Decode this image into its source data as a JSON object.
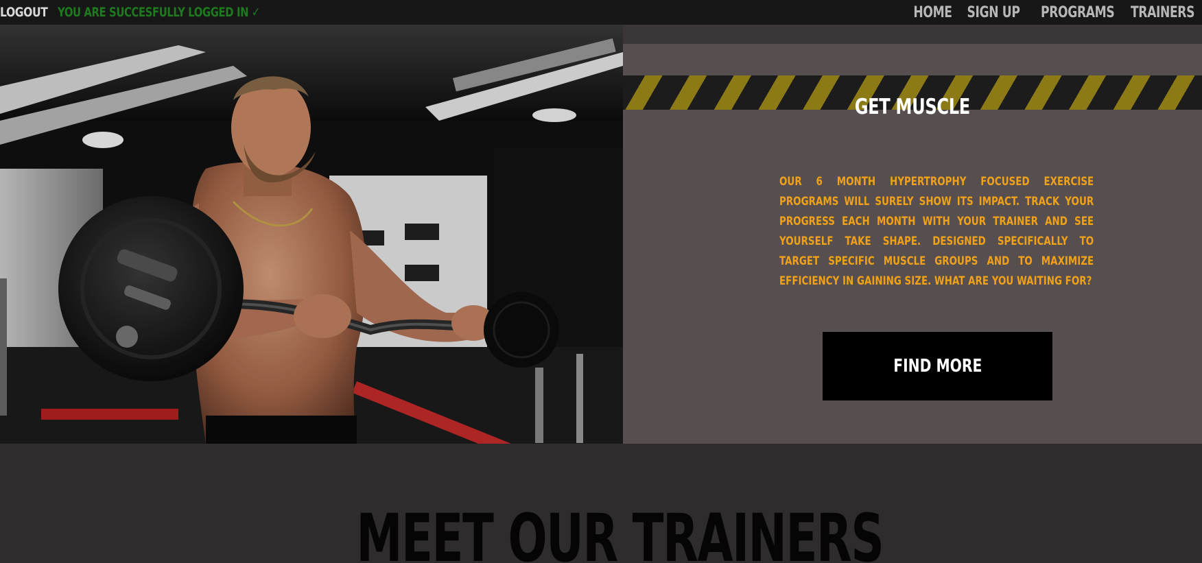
{
  "header": {
    "logout_label": "LOGOUT",
    "status_message": "YOU ARE SUCCESFULLY LOGGED IN ✓",
    "status_color": "#1f7a1f"
  },
  "nav": {
    "items": [
      {
        "label": "HOME"
      },
      {
        "label": "SIGN UP"
      },
      {
        "label": "PROGRAMS"
      },
      {
        "label": "TRAINERS"
      }
    ]
  },
  "hero": {
    "photo_icon": "bodybuilder-curling-ez-barbell-photo"
  },
  "program": {
    "title": "GET MUSCLE",
    "description": "OUR 6 MONTH HYPERTROPHY FOCUSED EXERCISE PROGRAMS WILL SURELY SHOW ITS IMPACT. TRACK YOUR PROGRESS EACH MONTH WITH YOUR TRAINER AND SEE YOURSELF TAKE SHAPE. DESIGNED SPECIFICALLY TO TARGET SPECIFIC MUSCLE GROUPS AND TO MAXIMIZE EFFICIENCY IN GAINING SIZE. WHAT ARE YOU WAITING FOR?",
    "cta_label": "FIND MORE",
    "accent_color": "#f0a11a",
    "hazard_colors": [
      "#1d1c1c",
      "#8c7a17"
    ]
  },
  "trainers_section": {
    "heading": "MEET OUR TRAINERS"
  }
}
